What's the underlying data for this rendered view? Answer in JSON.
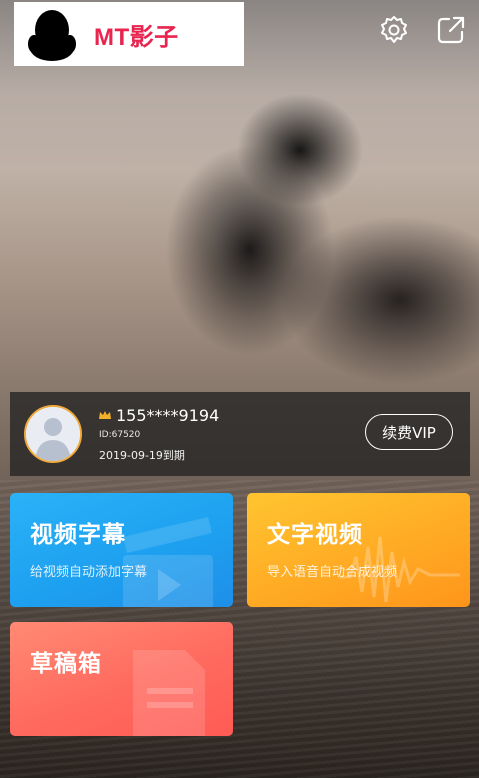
{
  "app": {
    "logo_text": "MT影子"
  },
  "top_bar": {
    "settings_icon": "gear-icon",
    "share_icon": "share-icon"
  },
  "user": {
    "phone": "155****9194",
    "id": "ID:67520",
    "expiry": "2019-09-19到期",
    "vip_button_label": "续费VIP"
  },
  "tiles": {
    "video_subtitle": {
      "title": "视频字幕",
      "subtitle": "给视频自动添加字幕",
      "color": "#1ea1f0"
    },
    "text_video": {
      "title": "文字视频",
      "subtitle": "导入语音自动合成视频",
      "color": "#ffab24"
    },
    "drafts": {
      "title": "草稿箱",
      "subtitle": "",
      "color": "#ff6a5f"
    }
  },
  "colors": {
    "logo_accent": "#e8244f",
    "avatar_ring": "#f0a93a"
  }
}
